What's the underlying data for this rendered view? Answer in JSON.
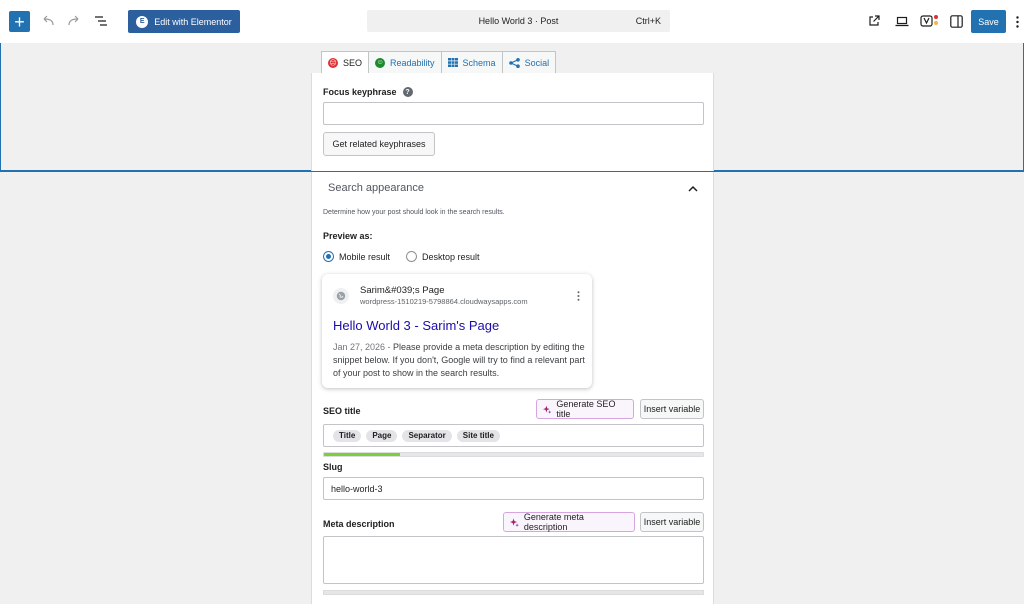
{
  "toolbar": {
    "add_icon": "plus-icon",
    "elementor_label": "Edit with Elementor",
    "document_title": "Hello World 3 · Post",
    "shortcut": "Ctrl+K",
    "save_label": "Save"
  },
  "tabs": [
    {
      "label": "SEO",
      "icon": "sad-face-icon"
    },
    {
      "label": "Readability",
      "icon": "smile-face-icon"
    },
    {
      "label": "Schema",
      "icon": "grid-icon"
    },
    {
      "label": "Social",
      "icon": "share-icon"
    }
  ],
  "seo": {
    "focus_keyphrase_label": "Focus keyphrase",
    "focus_keyphrase_value": "",
    "related_button": "Get related keyphrases",
    "search_appearance": "Search appearance",
    "description": "Determine how your post should look in the search results.",
    "preview_as": "Preview as:",
    "mobile_result": "Mobile result",
    "desktop_result": "Desktop result",
    "selected_preview": "Mobile result"
  },
  "serp": {
    "site_name": "Sarim&#039;s Page",
    "url": "wordpress-1510219-5798864.cloudwaysapps.com",
    "title": "Hello World 3 - Sarim's Page",
    "date": "Jan 27, 2026",
    "separator": " - ",
    "description": "Please provide a meta description by editing the snippet below. If you don't, Google will try to find a relevant part of your post to show in the search results."
  },
  "seo_title": {
    "label": "SEO title",
    "generate_button": "Generate SEO title",
    "insert_variable": "Insert variable",
    "variables": [
      "Title",
      "Page",
      "Separator",
      "Site title"
    ],
    "progress": 0.2
  },
  "slug": {
    "label": "Slug",
    "value": "hello-world-3"
  },
  "meta_description": {
    "label": "Meta description",
    "generate_button": "Generate meta description",
    "insert_variable": "Insert variable",
    "value": ""
  },
  "colors": {
    "accent": "#2271b1",
    "elementor": "#2b5f9e",
    "seo_status": "#dc3232",
    "readability_status": "#1e8a2e",
    "progress_good": "#7ad03a",
    "serp_link": "#1a0dab"
  }
}
